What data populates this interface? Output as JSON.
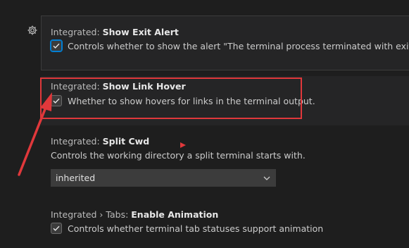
{
  "settings": {
    "exit_alert": {
      "category": "Integrated: ",
      "name": "Show Exit Alert",
      "description": "Controls whether to show the alert \"The terminal process terminated with exit code\"",
      "checked": true
    },
    "link_hover": {
      "category": "Integrated: ",
      "name": "Show Link Hover",
      "description": "Whether to show hovers for links in the terminal output.",
      "checked": true
    },
    "split_cwd": {
      "category": "Integrated: ",
      "name": "Split Cwd",
      "description": "Controls the working directory a split terminal starts with.",
      "value": "inherited"
    },
    "tab_animation": {
      "category": "Integrated › Tabs: ",
      "name": "Enable Animation",
      "description": "Controls whether terminal tab statuses support animation",
      "checked": true
    }
  },
  "icons": {
    "gear": "gear-icon",
    "check": "check-icon",
    "chevron": "chevron-down-icon",
    "play": "play-icon"
  },
  "colors": {
    "background": "#1e1e1e",
    "row_highlight": "#252526",
    "annotation_red": "#e0383b",
    "focus_blue": "#007fd4"
  }
}
